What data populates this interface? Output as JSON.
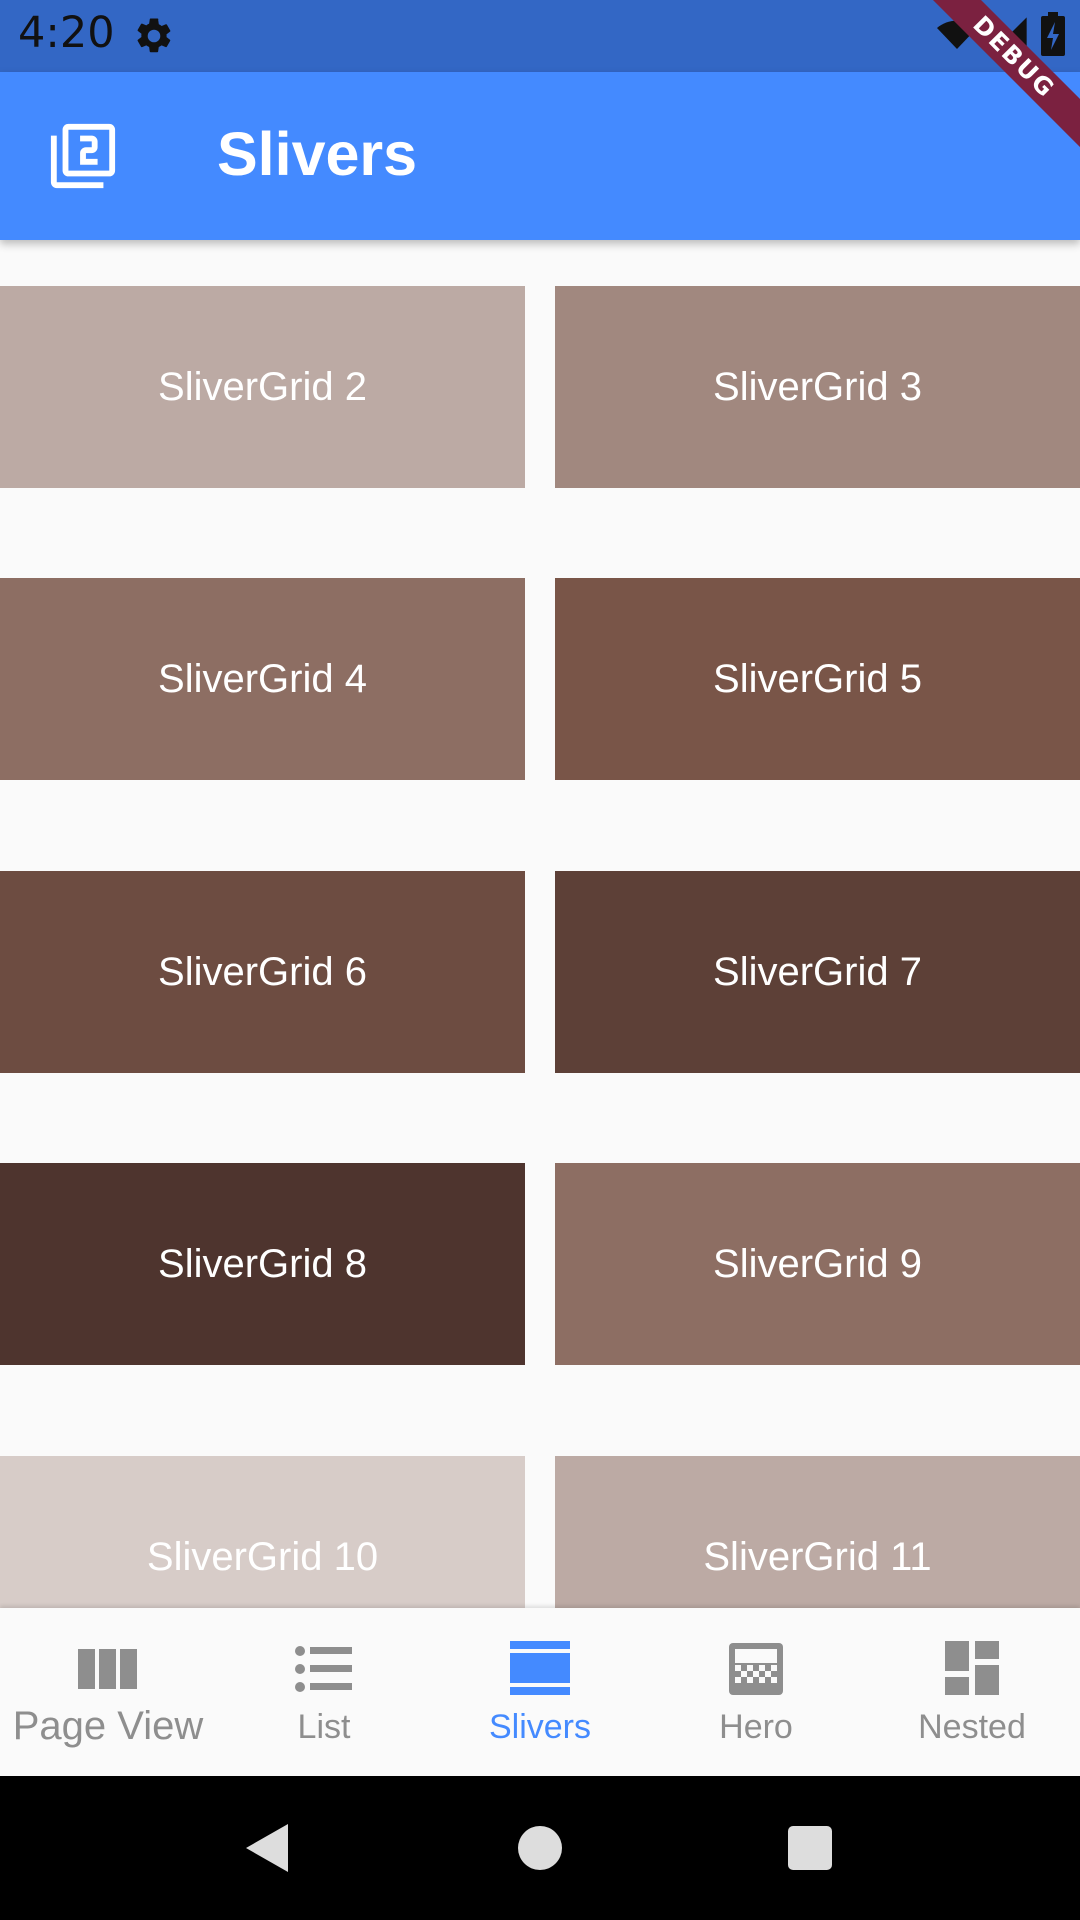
{
  "status_bar": {
    "time": "4:20",
    "icons": [
      "gear-icon",
      "wifi-icon",
      "signal-icon",
      "battery-icon"
    ]
  },
  "debug_banner": "DEBUG",
  "app_bar": {
    "title": "Slivers",
    "icon": "filter-2-icon",
    "background": "#448aff"
  },
  "grid": {
    "tiles": [
      {
        "label": "SliverGrid 2",
        "color": "#bcaaa4"
      },
      {
        "label": "SliverGrid 3",
        "color": "#a1887f"
      },
      {
        "label": "SliverGrid 4",
        "color": "#8d6e63"
      },
      {
        "label": "SliverGrid 5",
        "color": "#795548"
      },
      {
        "label": "SliverGrid 6",
        "color": "#6d4c41"
      },
      {
        "label": "SliverGrid 7",
        "color": "#5d4037"
      },
      {
        "label": "SliverGrid 8",
        "color": "#4e342e"
      },
      {
        "label": "SliverGrid 9",
        "color": "#8d6e63"
      },
      {
        "label": "SliverGrid 10",
        "color": "#d7ccc8"
      },
      {
        "label": "SliverGrid 11",
        "color": "#bcaaa4"
      }
    ]
  },
  "bottom_nav": {
    "items": [
      {
        "label": "Page View",
        "icon": "view-column-icon",
        "active": false
      },
      {
        "label": "List",
        "icon": "list-icon",
        "active": false
      },
      {
        "label": "Slivers",
        "icon": "view-stream-icon",
        "active": true
      },
      {
        "label": "Hero",
        "icon": "hero-image-icon",
        "active": false
      },
      {
        "label": "Nested",
        "icon": "dashboard-icon",
        "active": false
      }
    ],
    "active_color": "#448aff",
    "inactive_color": "#8e8e8e"
  },
  "system_nav": {
    "buttons": [
      "back-icon",
      "home-icon",
      "recents-icon"
    ]
  }
}
